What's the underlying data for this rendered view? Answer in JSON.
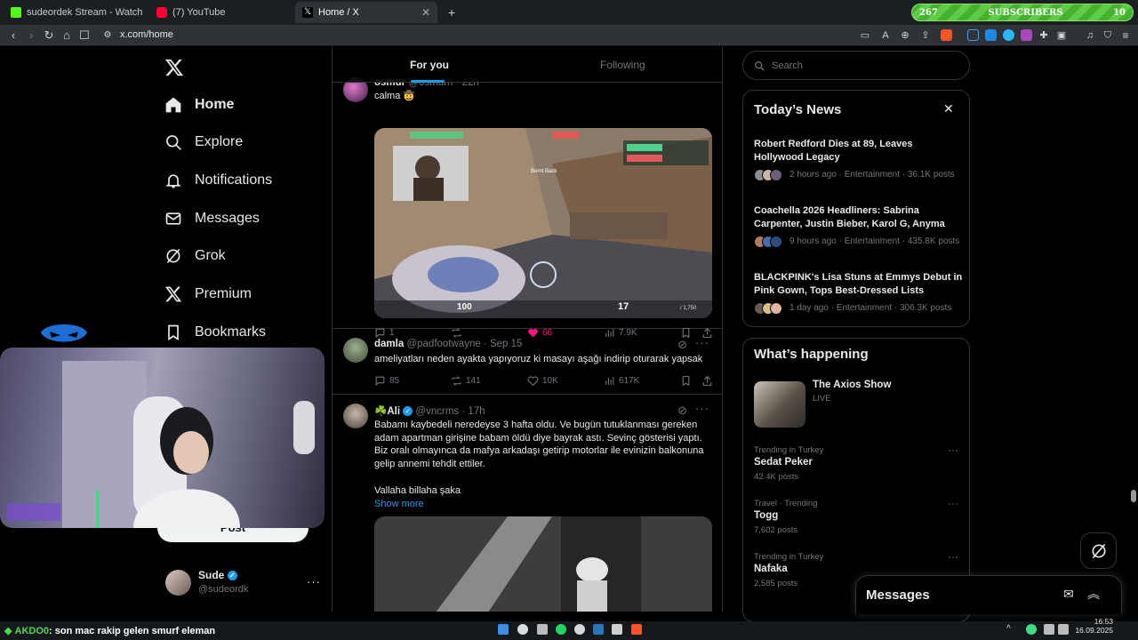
{
  "browser": {
    "tabs": [
      {
        "title": "sudeordek Stream - Watch Live on Ki",
        "favicon_color": "#53fc18"
      },
      {
        "title": "(7) YouTube",
        "favicon_color": "#ff0033"
      },
      {
        "title": "Home / X",
        "favicon_color": "#ffffff"
      }
    ],
    "new_tab_label": "+",
    "url": "x.com/home",
    "subscribers_widget": {
      "left": "267",
      "label": "SUBSCRIBERS",
      "right": "10"
    }
  },
  "sidebar": {
    "items": [
      {
        "label": "Home",
        "icon": "home-icon"
      },
      {
        "label": "Explore",
        "icon": "search-icon"
      },
      {
        "label": "Notifications",
        "icon": "bell-icon"
      },
      {
        "label": "Messages",
        "icon": "mail-icon"
      },
      {
        "label": "Grok",
        "icon": "grok-icon"
      },
      {
        "label": "Premium",
        "icon": "x-logo-icon"
      },
      {
        "label": "Bookmarks",
        "icon": "bookmark-icon"
      }
    ],
    "post_button": "Post",
    "account": {
      "name": "Sude",
      "handle": "@sudeordk"
    }
  },
  "feed": {
    "tabs": [
      "For you",
      "Following"
    ],
    "tweets": [
      {
        "name": "osmur",
        "handle": "@osmurn",
        "time": "22h",
        "text": "calma 🤠",
        "stats": {
          "replies": "1",
          "retweets": "",
          "likes": "66",
          "views": "7.9K"
        },
        "liked": true
      },
      {
        "name": "damla",
        "handle": "@padfootwayne",
        "time": "Sep 15",
        "text": "ameliyatları neden ayakta yapıyoruz ki masayı aşağı indirip oturarak yapsak",
        "stats": {
          "replies": "85",
          "retweets": "141",
          "likes": "10K",
          "views": "617K"
        },
        "liked": false
      },
      {
        "name": "☘️Ali",
        "handle": "@vncrms",
        "time": "17h",
        "text": "Babamı kaybedeli neredeyse 3 hafta oldu. Ve bugün tutuklanması gereken adam apartman girişine babam öldü diye bayrak astı. Sevinç gösterisi yaptı. Biz oralı olmayınca da mafya arkadaşı getirip motorlar ile evinizin balkonuna gelip annemi tehdit ettiler.",
        "text2": "Vallaha billaha şaka",
        "show_more": "Show more"
      }
    ],
    "game_hud": {
      "health": "100",
      "ammo": "17",
      "ammo_reserve": "/ 1,750",
      "callout": "Burnt Back"
    }
  },
  "right": {
    "search_placeholder": "Search",
    "news": {
      "title": "Today’s News",
      "items": [
        {
          "headline": "Robert Redford Dies at 89, Leaves Hollywood Legacy",
          "meta": "2 hours ago · Entertainment · 36.1K posts"
        },
        {
          "headline": "Coachella 2026 Headliners: Sabrina Carpenter, Justin Bieber, Karol G, Anyma",
          "meta": "9 hours ago · Entertainment · 435.8K posts"
        },
        {
          "headline": "BLACKPINK's Lisa Stuns at Emmys Debut in Pink Gown, Tops Best-Dressed Lists",
          "meta": "1 day ago · Entertainment · 306.3K posts"
        }
      ]
    },
    "happening": {
      "title": "What’s happening",
      "live": {
        "name": "The Axios Show",
        "status": "LIVE"
      },
      "trends": [
        {
          "category": "Trending in Turkey",
          "name": "Sedat Peker",
          "count": "42.4K posts"
        },
        {
          "category": "Travel · Trending",
          "name": "Togg",
          "count": "7,602 posts"
        },
        {
          "category": "Trending in Turkey",
          "name": "Nafaka",
          "count": "2,585 posts"
        }
      ]
    },
    "messages_dock": "Messages"
  },
  "overlay": {
    "chat": {
      "user": "AKDO0",
      "message": ": son mac rakip gelen smurf eleman"
    }
  },
  "taskbar": {
    "time": "16:53",
    "date": "16.09.2025"
  },
  "colors": {
    "accent": "#1d9bf0",
    "like": "#f91880",
    "border": "#2f3336",
    "muted": "#71767b"
  }
}
